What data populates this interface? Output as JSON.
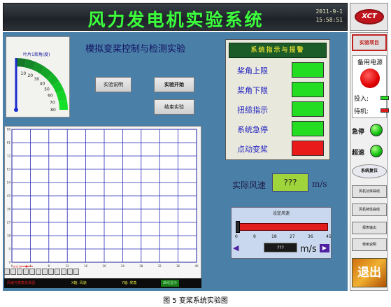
{
  "header": {
    "title": "风力发电机实验系统",
    "date": "2011-9-1",
    "time": "15:58:51",
    "logo_text": "XCT"
  },
  "gauge": {
    "label": "叶片1桨角(度)",
    "ticks": [
      "0",
      "10",
      "20",
      "30",
      "40",
      "50",
      "60",
      "70",
      "80"
    ],
    "value": 0
  },
  "module": {
    "title": "模拟变桨控制与检测实验",
    "btn_manual": "实验说明",
    "btn_start": "实验开始",
    "btn_end": "结束实验"
  },
  "status": {
    "header": "系统指示与报警",
    "items": [
      {
        "label": "桨角上限",
        "color": "#22dd22"
      },
      {
        "label": "桨角下限",
        "color": "#22dd22"
      },
      {
        "label": "扭缆指示",
        "color": "#22dd22"
      },
      {
        "label": "系统急停",
        "color": "#22dd22"
      },
      {
        "label": "点动变桨",
        "color": "#e81a1a"
      }
    ]
  },
  "chart_data": {
    "type": "line",
    "x_ticks": [
      "0",
      "4",
      "8",
      "12",
      "16",
      "20",
      "24",
      "28",
      "32",
      "36",
      "40"
    ],
    "y_ticks": [
      "0",
      "9",
      "18",
      "27",
      "36",
      "45",
      "54",
      "63",
      "72",
      "81",
      "90"
    ],
    "xlim": [
      0,
      40
    ],
    "ylim": [
      0,
      90
    ],
    "grid": true,
    "legend": "bottom-left",
    "series": [
      {
        "name": "叶片1",
        "color": "#e02020",
        "x": [],
        "y": []
      }
    ]
  },
  "chart_status": {
    "title": "风速与桨角关系图",
    "x_label": "X轴: 风速",
    "y_label": "Y轴: 桨角",
    "button": "曲线显示"
  },
  "wind": {
    "label": "实际风速",
    "value": "???",
    "unit": "m/s"
  },
  "wind_set": {
    "title": "设定风速",
    "ticks": [
      "0",
      "9",
      "18",
      "27",
      "36",
      "45"
    ],
    "value": "???",
    "unit": "m/s",
    "level": 0
  },
  "side": {
    "header": "实验项目",
    "backup_title": "备用电源",
    "input_label": "投入:",
    "standby_label": "待机:",
    "input_color": "#22dd22",
    "standby_color": "#e01a1a",
    "estop_label": "急停",
    "overspeed_label": "超速",
    "reset_label": "系统复位",
    "buttons": [
      "风机功率曲线",
      "风机特性曲线",
      "报表输出",
      "使用说明"
    ],
    "exit_label": "退出"
  },
  "caption": "图 5  变桨系统实验图"
}
